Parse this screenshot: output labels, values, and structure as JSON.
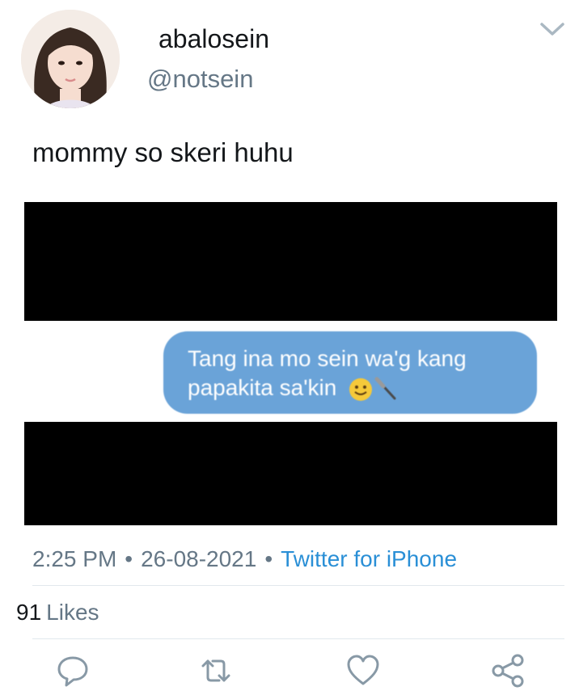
{
  "user": {
    "display_name": "abalosein",
    "handle": "@notsein"
  },
  "tweet": {
    "text": "mommy so skeri huhu",
    "media": {
      "message_line1": "Tang ina mo sein wa'g kang",
      "message_line2": "papakita sa'kin"
    },
    "time": "2:25 PM",
    "date": "26-08-2021",
    "source": "Twitter for iPhone",
    "likes_count": "91",
    "likes_label": "Likes"
  },
  "icons": {
    "menu": "chevron-down-icon",
    "reply": "reply-icon",
    "retweet": "retweet-icon",
    "like": "heart-icon",
    "share": "share-icon"
  },
  "colors": {
    "secondary_text": "#657786",
    "link": "#2a8fd6",
    "bubble": "#6aa3d8"
  }
}
